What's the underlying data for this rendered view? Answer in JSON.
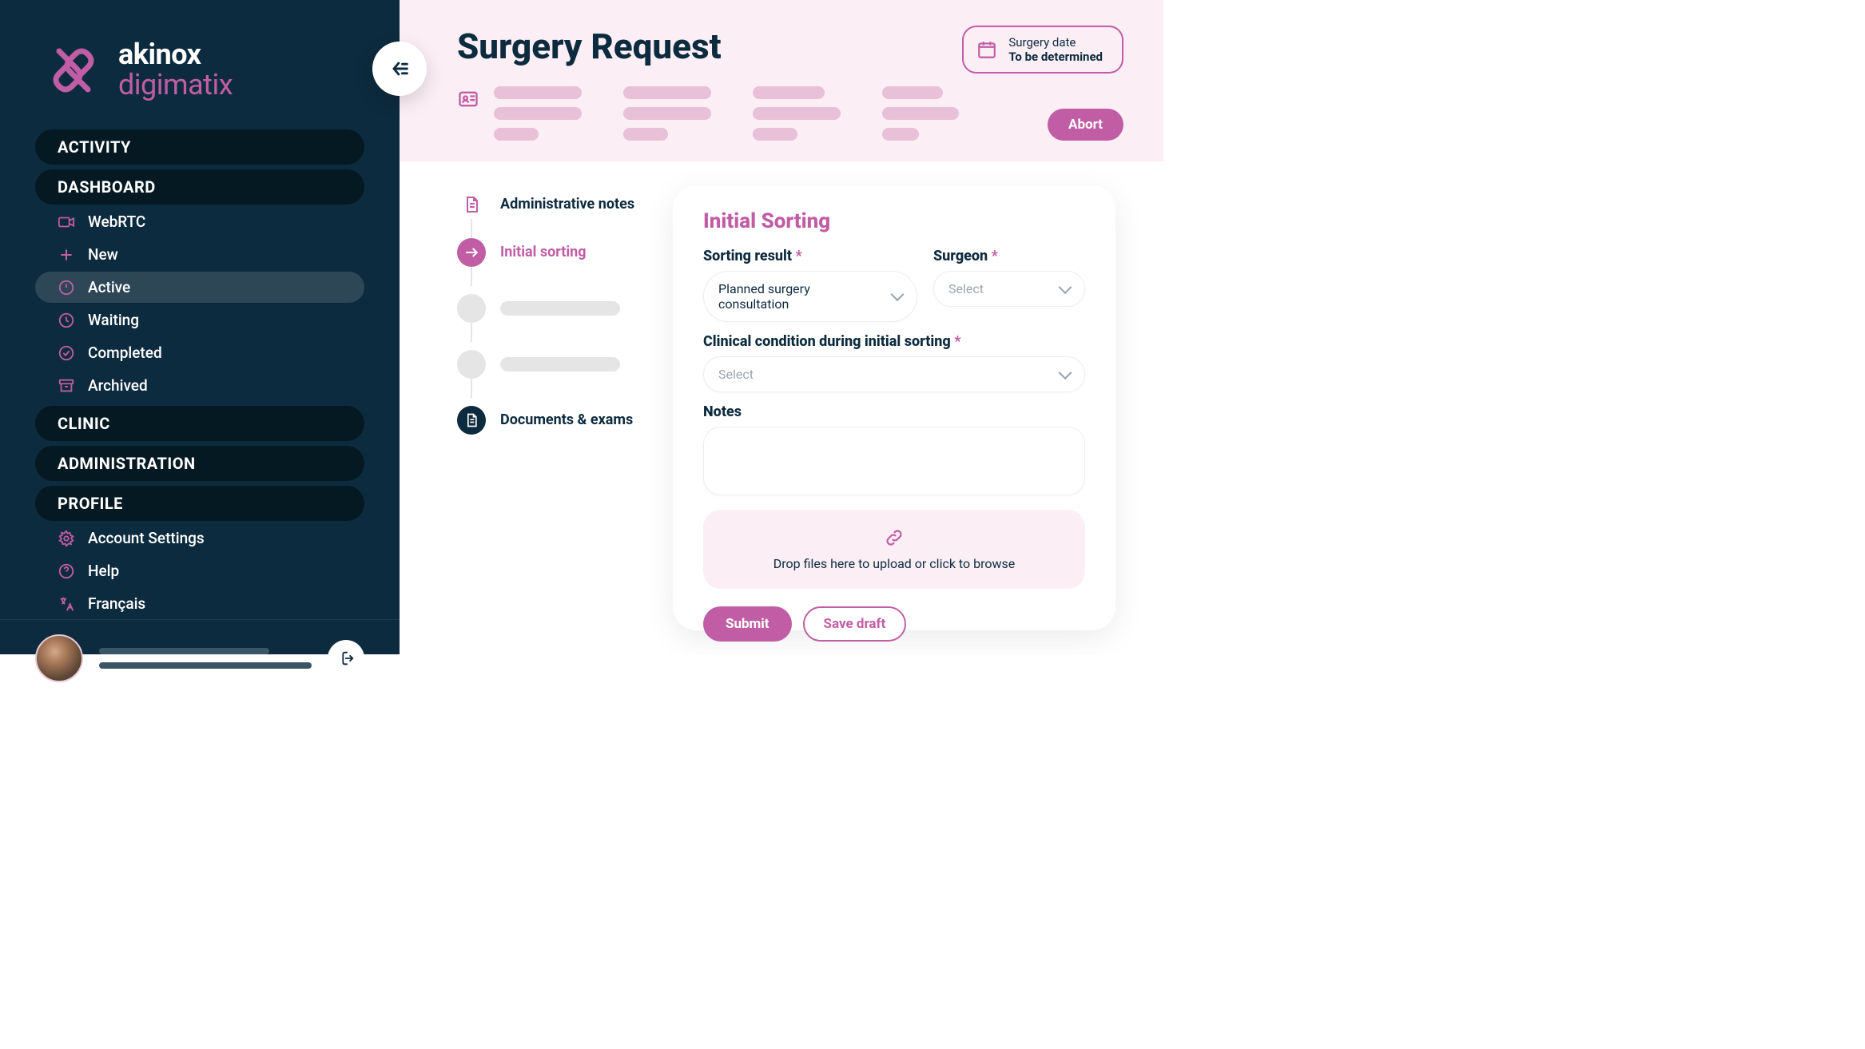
{
  "brand": {
    "line1": "akinox",
    "line2": "digimatix"
  },
  "nav": {
    "activity": "ACTIVITY",
    "dashboard": "DASHBOARD",
    "dashboard_items": {
      "webrtc": "WebRTC",
      "newitem": "New",
      "active": "Active",
      "waiting": "Waiting",
      "completed": "Completed",
      "archived": "Archived"
    },
    "clinic": "CLINIC",
    "administration": "ADMINISTRATION",
    "profile": "PROFILE",
    "profile_items": {
      "account": "Account Settings",
      "help": "Help",
      "lang": "Français"
    }
  },
  "page": {
    "title": "Surgery Request",
    "surgery_date_label": "Surgery date",
    "surgery_date_value": "To be determined",
    "abort": "Abort"
  },
  "steps": {
    "admin_notes": "Administrative notes",
    "initial_sorting": "Initial sorting",
    "documents": "Documents & exams"
  },
  "form": {
    "title": "Initial Sorting",
    "sorting_result_label": "Sorting result",
    "sorting_result_value": "Planned surgery consultation",
    "surgeon_label": "Surgeon",
    "surgeon_placeholder": "Select",
    "clinical_label": "Clinical condition during initial sorting",
    "clinical_placeholder": "Select",
    "notes_label": "Notes",
    "dropzone": "Drop files here to upload or click to browse",
    "submit": "Submit",
    "save_draft": "Save draft"
  }
}
